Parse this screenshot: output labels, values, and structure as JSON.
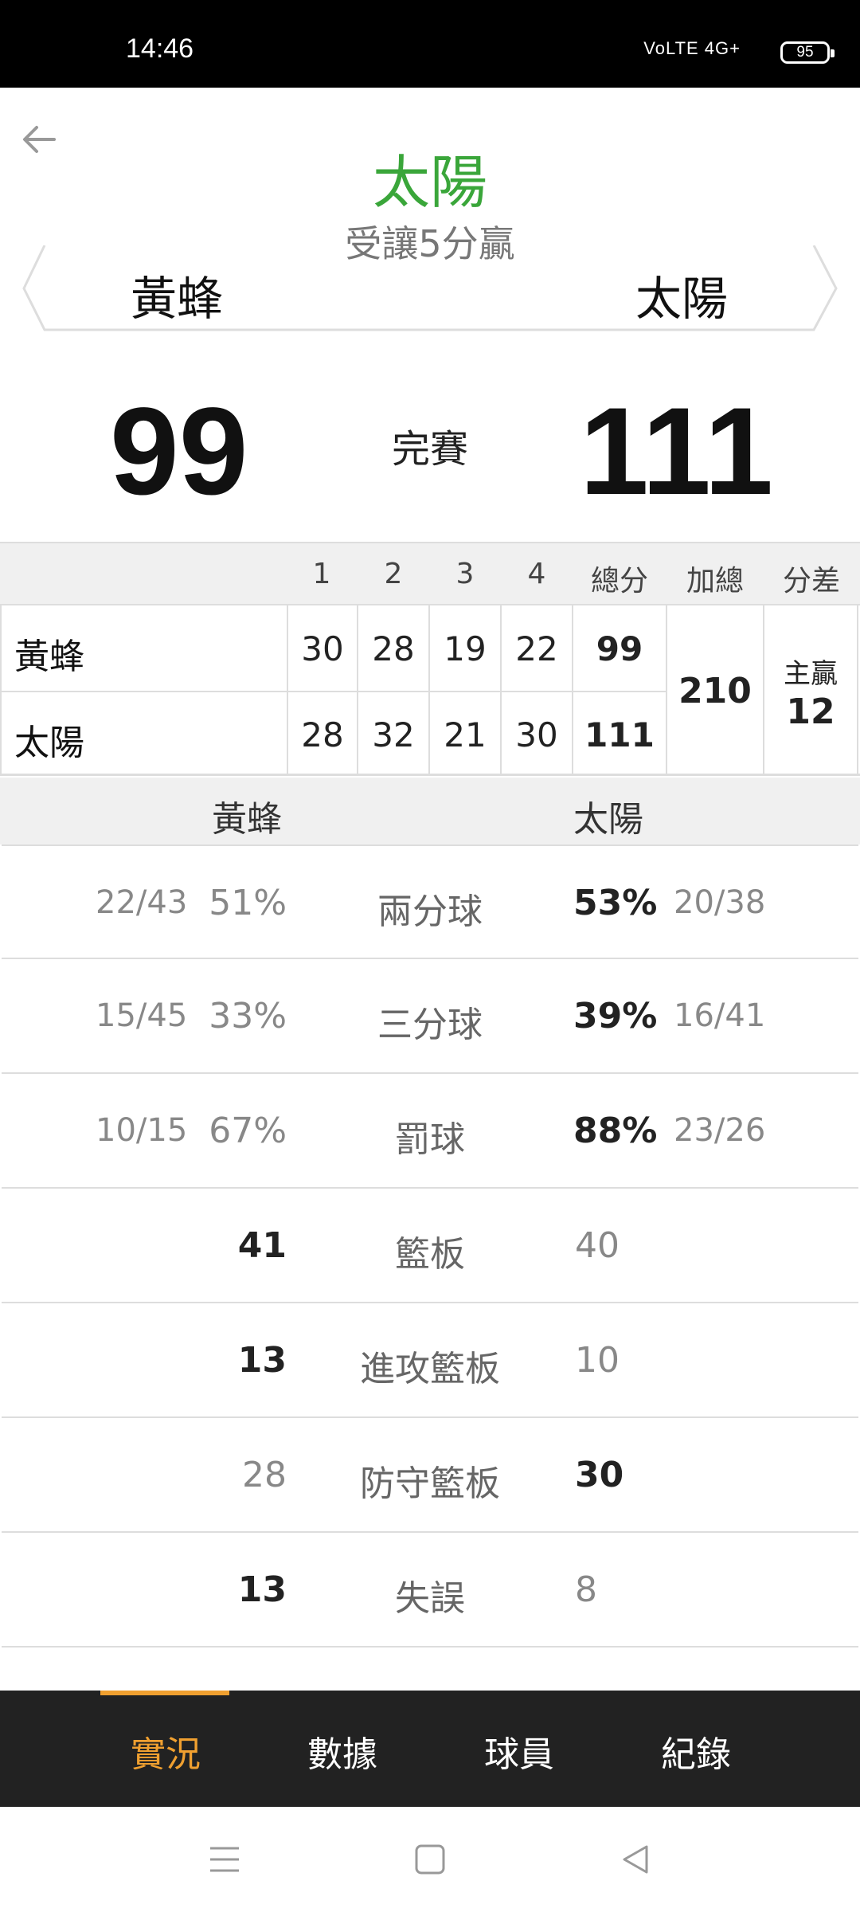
{
  "status_bar": {
    "time": "14:46",
    "signal": "VoLTE 4G+",
    "battery": "95"
  },
  "header": {
    "winner": "太陽",
    "spread_note": "受讓5分贏",
    "away_team": "黃蜂",
    "home_team": "太陽"
  },
  "score": {
    "away": "99",
    "status": "完賽",
    "home": "111"
  },
  "quarter_table": {
    "headers": [
      "1",
      "2",
      "3",
      "4",
      "總分",
      "加總",
      "分差"
    ],
    "rows": [
      {
        "team": "黃蜂",
        "q": [
          "30",
          "28",
          "19",
          "22"
        ],
        "total": "99"
      },
      {
        "team": "太陽",
        "q": [
          "28",
          "32",
          "21",
          "30"
        ],
        "total": "111"
      }
    ],
    "combined": "210",
    "diff_label": "主贏",
    "diff": "12"
  },
  "stats": {
    "away_team": "黃蜂",
    "home_team": "太陽",
    "shooting": [
      {
        "label": "兩分球",
        "away_frac": "22/43",
        "away_pct": "51%",
        "home_pct": "53%",
        "home_frac": "20/38"
      },
      {
        "label": "三分球",
        "away_frac": "15/45",
        "away_pct": "33%",
        "home_pct": "39%",
        "home_frac": "16/41"
      },
      {
        "label": "罰球",
        "away_frac": "10/15",
        "away_pct": "67%",
        "home_pct": "88%",
        "home_frac": "23/26"
      }
    ],
    "counts": [
      {
        "label": "籃板",
        "away": "41",
        "home": "40"
      },
      {
        "label": "進攻籃板",
        "away": "13",
        "home": "10"
      },
      {
        "label": "防守籃板",
        "away": "28",
        "home": "30"
      },
      {
        "label": "失誤",
        "away": "13",
        "home": "8"
      }
    ]
  },
  "tabs": [
    "實況",
    "數據",
    "球員",
    "紀錄"
  ],
  "colors": {
    "winner": "#3aa63a",
    "accent": "#f0a030",
    "nav_bg": "#222222"
  }
}
